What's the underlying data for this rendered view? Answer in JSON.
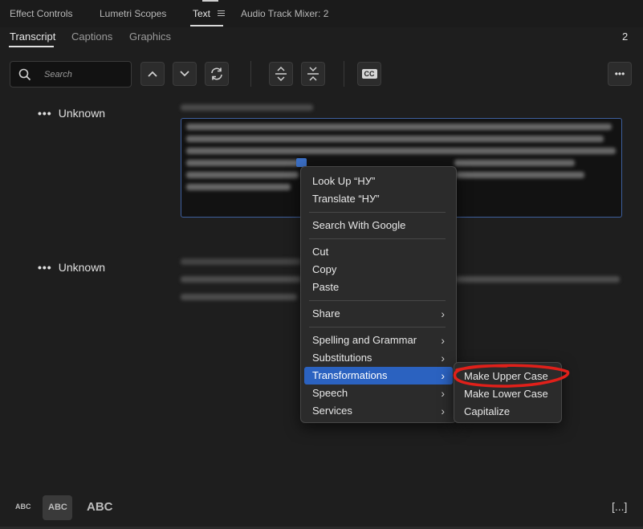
{
  "panel_tabs": [
    "Effect Controls",
    "Lumetri Scopes",
    "Text",
    "Audio Track Mixer: 2"
  ],
  "sub_tabs": [
    "Transcript",
    "Captions",
    "Graphics"
  ],
  "count": "2",
  "search": {
    "placeholder": "Search"
  },
  "toolbar": {
    "icons": [
      "chevron-up-icon",
      "chevron-down-icon",
      "sync-icon",
      "expand-icon",
      "collapse-icon",
      "cc-icon",
      "more-icon"
    ],
    "cc_label": "CC",
    "more_label": "•••"
  },
  "transcript": {
    "blocks": [
      {
        "speaker": "Unknown",
        "dots": "•••"
      },
      {
        "speaker": "Unknown",
        "dots": "•••"
      }
    ]
  },
  "context_menu": {
    "items": [
      {
        "label": "Look Up “НУ”"
      },
      {
        "label": "Translate “НУ”"
      },
      {
        "label": "Search With Google"
      },
      {
        "label": "Cut"
      },
      {
        "label": "Copy"
      },
      {
        "label": "Paste"
      },
      {
        "label": "Share",
        "submenu": true
      },
      {
        "label": "Spelling and Grammar",
        "submenu": true
      },
      {
        "label": "Substitutions",
        "submenu": true
      },
      {
        "label": "Transformations",
        "submenu": true,
        "highlighted": true
      },
      {
        "label": "Speech",
        "submenu": true
      },
      {
        "label": "Services",
        "submenu": true
      }
    ],
    "chevron": "›"
  },
  "submenu": {
    "items": [
      "Make Upper Case",
      "Make Lower Case",
      "Capitalize"
    ]
  },
  "bottom_bar": {
    "abc_small": "ABC",
    "abc_medium": "ABC",
    "abc_large": "ABC",
    "bracket": "[...]"
  },
  "colors": {
    "highlight": "#2b62c0",
    "annotation_red": "#e0201a",
    "active_border": "#3e5f9e"
  }
}
